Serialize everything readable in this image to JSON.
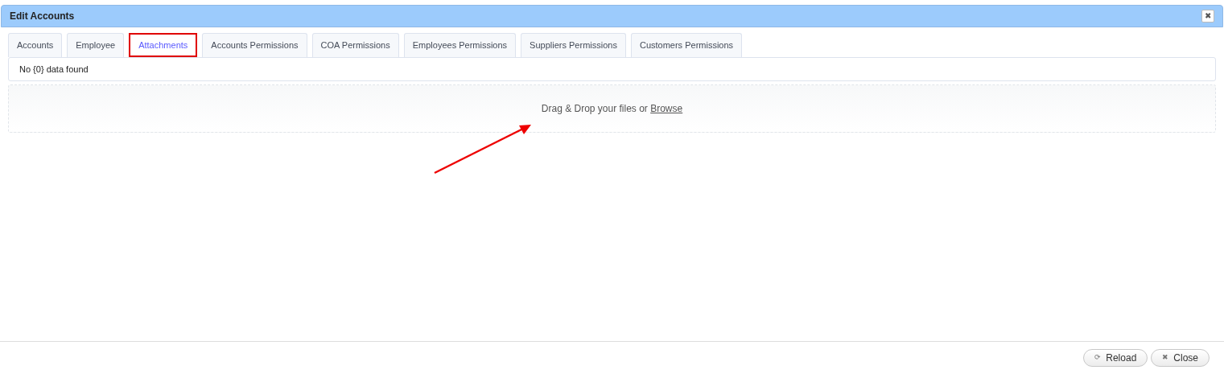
{
  "window": {
    "title": "Edit Accounts",
    "close_icon": "✖"
  },
  "tabs": [
    {
      "label": "Accounts",
      "selected": false
    },
    {
      "label": "Employee",
      "selected": false
    },
    {
      "label": "Attachments",
      "selected": true
    },
    {
      "label": "Accounts Permissions",
      "selected": false
    },
    {
      "label": "COA Permissions",
      "selected": false
    },
    {
      "label": "Employees Permissions",
      "selected": false
    },
    {
      "label": "Suppliers Permissions",
      "selected": false
    },
    {
      "label": "Customers Permissions",
      "selected": false
    }
  ],
  "message": "No {0} data found",
  "dropzone": {
    "text": "Drag & Drop your files or",
    "link": "Browse"
  },
  "buttons": [
    {
      "label": "Reload",
      "icon": "⟳"
    },
    {
      "label": "Close",
      "icon": "✖"
    }
  ]
}
